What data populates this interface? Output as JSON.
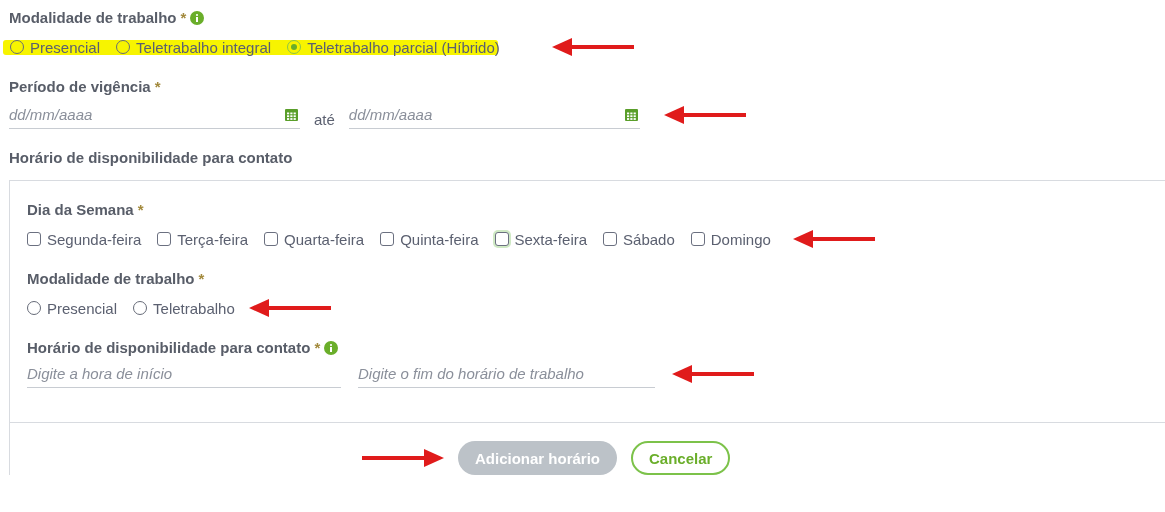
{
  "work_mode": {
    "label": "Modalidade de trabalho",
    "required": "*",
    "info": true,
    "highlighted": true,
    "arrow": true,
    "options": [
      {
        "label": "Presencial",
        "selected": false
      },
      {
        "label": "Teletrabalho integral",
        "selected": false
      },
      {
        "label": "Teletrabalho parcial (Híbrido)",
        "selected": true
      }
    ]
  },
  "period": {
    "label": "Período de vigência",
    "required": "*",
    "arrow": true,
    "start": {
      "placeholder": "dd/mm/aaaa"
    },
    "separator": "até",
    "end": {
      "placeholder": "dd/mm/aaaa"
    }
  },
  "availability": {
    "title": "Horário de disponibilidade para contato",
    "weekday": {
      "label": "Dia da Semana",
      "required": "*",
      "arrow": true,
      "days": [
        {
          "label": "Segunda-feira",
          "checked": false,
          "focused": false
        },
        {
          "label": "Terça-feira",
          "checked": false,
          "focused": false
        },
        {
          "label": "Quarta-feira",
          "checked": false,
          "focused": false
        },
        {
          "label": "Quinta-feira",
          "checked": false,
          "focused": false
        },
        {
          "label": "Sexta-feira",
          "checked": false,
          "focused": true
        },
        {
          "label": "Sábado",
          "checked": false,
          "focused": false
        },
        {
          "label": "Domingo",
          "checked": false,
          "focused": false
        }
      ]
    },
    "mode": {
      "label": "Modalidade de trabalho",
      "required": "*",
      "arrow": true,
      "options": [
        {
          "label": "Presencial",
          "selected": false
        },
        {
          "label": "Teletrabalho",
          "selected": false
        }
      ]
    },
    "hours": {
      "label": "Horário de disponibilidade para contato",
      "required": "*",
      "info": true,
      "arrow": true,
      "start": {
        "placeholder": "Digite a hora de início"
      },
      "end": {
        "placeholder": "Digite o fim do horário de trabalho"
      }
    },
    "actions": {
      "arrow": true,
      "add": {
        "label": "Adicionar horário",
        "disabled": true
      },
      "cancel": {
        "label": "Cancelar"
      }
    }
  }
}
